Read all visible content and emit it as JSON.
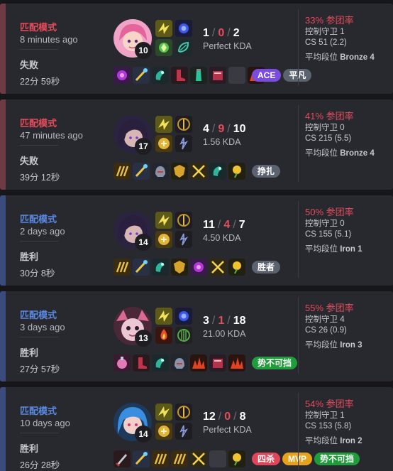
{
  "matches": [
    {
      "outcome": "loss",
      "mode": "匹配模式",
      "ago": "8 minutes ago",
      "result": "失败",
      "duration": "22分 59秒",
      "level": "10",
      "kills": "1",
      "deaths": "0",
      "assists": "2",
      "ratio": "Perfect KDA",
      "kill_participation": "33% 参团率",
      "ward_line": "控制守卫 1",
      "cs_line": "CS 51 (2.2)",
      "rank_prefix": "平均段位",
      "rank": "Bronze 4",
      "champion": "pink-haired-champion",
      "items": [
        "item-violet-tome",
        "item-gold-wand",
        "item-teal-orb",
        "item-red-boots",
        "item-green-potion",
        "item-red-book",
        "empty",
        "item-red-spikes"
      ],
      "badges": [
        {
          "label": "ACE",
          "color": "#7b4ce0"
        },
        {
          "label": "平凡",
          "color": "#5b6270"
        }
      ]
    },
    {
      "outcome": "loss",
      "mode": "匹配模式",
      "ago": "47 minutes ago",
      "result": "失败",
      "duration": "39分 12秒",
      "level": "17",
      "kills": "4",
      "deaths": "9",
      "assists": "10",
      "ratio": "1.56 KDA",
      "kill_participation": "41% 参团率",
      "ward_line": "控制守卫 0",
      "cs_line": "CS 215 (5.5)",
      "rank_prefix": "平均段位",
      "rank": "Bronze 4",
      "champion": "dark-haired-champion",
      "items": [
        "item-gold-claw",
        "item-gold-wand",
        "item-grey-helm",
        "item-gold-shield",
        "item-cross-blades",
        "item-teal-orb",
        "item-gold-flower"
      ],
      "badges": [
        {
          "label": "挣扎",
          "color": "#5b6270"
        }
      ]
    },
    {
      "outcome": "win",
      "mode": "匹配模式",
      "ago": "2 days ago",
      "result": "胜利",
      "duration": "30分 8秒",
      "level": "14",
      "kills": "11",
      "deaths": "4",
      "assists": "7",
      "ratio": "4.50 KDA",
      "kill_participation": "50% 参团率",
      "ward_line": "控制守卫 0",
      "cs_line": "CS 155 (5.1)",
      "rank_prefix": "平均段位",
      "rank": "Iron 1",
      "champion": "dark-haired-champion",
      "items": [
        "item-gold-claw",
        "item-gold-wand",
        "item-teal-orb",
        "item-gold-shield",
        "item-violet-tome",
        "item-cross-blades",
        "item-gold-flower"
      ],
      "badges": [
        {
          "label": "胜者",
          "color": "#5b6270"
        }
      ]
    },
    {
      "outcome": "win",
      "mode": "匹配模式",
      "ago": "3 days ago",
      "result": "胜利",
      "duration": "27分 57秒",
      "level": "13",
      "kills": "3",
      "deaths": "1",
      "assists": "18",
      "ratio": "21.00 KDA",
      "kill_participation": "55% 参团率",
      "ward_line": "控制守卫 4",
      "cs_line": "CS 26 (0.9)",
      "rank_prefix": "平均段位",
      "rank": "Iron 3",
      "champion": "pink-yordle-champion",
      "items": [
        "item-pink-potion",
        "item-red-boots",
        "item-teal-orb",
        "item-grey-helm",
        "item-red-spikes",
        "item-red-book",
        "item-red-spikes"
      ],
      "badges": [
        {
          "label": "势不可挡",
          "color": "#1f9d3a"
        }
      ]
    },
    {
      "outcome": "win",
      "mode": "匹配模式",
      "ago": "10 days ago",
      "result": "胜利",
      "duration": "26分 28秒",
      "level": "14",
      "kills": "12",
      "deaths": "0",
      "assists": "8",
      "ratio": "Perfect KDA",
      "kill_participation": "54% 参团率",
      "ward_line": "控制守卫 1",
      "cs_line": "CS 153 (5.8)",
      "rank_prefix": "平均段位",
      "rank": "Iron 2",
      "champion": "blue-haired-champion",
      "items": [
        "item-red-dagger",
        "item-gold-wand",
        "item-gold-claw",
        "item-gold-claw",
        "item-cross-blades",
        "empty",
        "item-gold-flower"
      ],
      "badges": [
        {
          "label": "四杀",
          "color": "#e0465a"
        },
        {
          "label": "MVP",
          "color": "#e6a21a"
        },
        {
          "label": "势不可挡",
          "color": "#1f9d3a"
        }
      ]
    }
  ],
  "spells_1": [
    "flash-icon",
    "blue-orb-icon",
    "glyph-icon",
    "leaf-icon"
  ],
  "spells_2": [
    "flash-icon",
    "shield-rune-icon",
    "heal-icon",
    "spiral-rune-icon"
  ],
  "colors": {
    "kill_participation": "#e34d5c",
    "loss_bar": "#6e3a44",
    "win_bar": "#3b4c7c"
  }
}
